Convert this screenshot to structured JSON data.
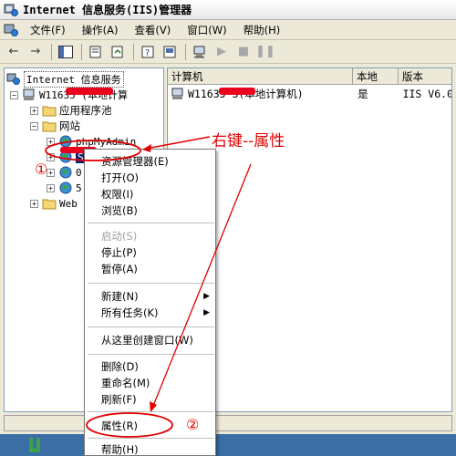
{
  "window": {
    "title": "Internet 信息服务(IIS)管理器"
  },
  "menu": {
    "items": [
      {
        "label": "文件(F)"
      },
      {
        "label": "操作(A)"
      },
      {
        "label": "查看(V)"
      },
      {
        "label": "窗口(W)"
      },
      {
        "label": "帮助(H)"
      }
    ]
  },
  "toolbar": {
    "buttons": [
      "back-icon",
      "forward-icon",
      "show-tree-icon",
      "properties-icon",
      "export-icon",
      "help-icon",
      "console-icon",
      "start-icon",
      "stop-icon",
      "pause-icon"
    ]
  },
  "tree": {
    "root": "Internet 信息服务",
    "computer": "W11635      (本地计算",
    "app_pools": "应用程序池",
    "websites": "网站",
    "site_phpmyadmin": "phpMyAdmin",
    "site_selected": "S",
    "site_3": "0",
    "site_4": "5",
    "web_ext": "Web"
  },
  "list": {
    "headers": [
      "计算机",
      "本地",
      "版本"
    ],
    "row": {
      "computer": "W11635        3(本地计算机)",
      "local": "是",
      "version": "IIS V6.0"
    }
  },
  "context_menu": {
    "items": [
      {
        "label": "资源管理器(E)"
      },
      {
        "label": "打开(O)"
      },
      {
        "label": "权限(I)"
      },
      {
        "label": "浏览(B)"
      },
      {
        "label": "启动(S)"
      },
      {
        "label": "停止(P)"
      },
      {
        "label": "暂停(A)"
      },
      {
        "label": "新建(N)"
      },
      {
        "label": "所有任务(K)"
      },
      {
        "label": "从这里创建窗口(W)"
      },
      {
        "label": "删除(D)"
      },
      {
        "label": "重命名(M)"
      },
      {
        "label": "刷新(F)"
      },
      {
        "label": "属性(R)"
      },
      {
        "label": "帮助(H)"
      }
    ]
  },
  "annotations": {
    "right_click_note": "右键--属性",
    "step1": "①",
    "step2": "②",
    "color": "#e00000"
  }
}
